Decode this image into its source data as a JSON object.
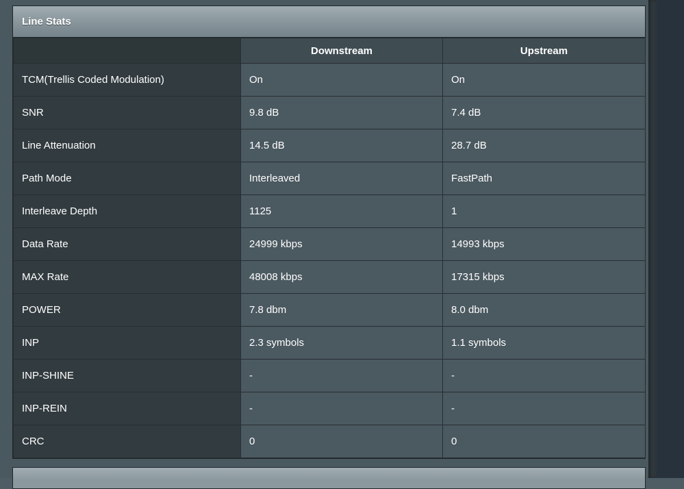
{
  "panel": {
    "title": "Line Stats"
  },
  "columns": {
    "downstream": "Downstream",
    "upstream": "Upstream"
  },
  "rows": [
    {
      "label": "TCM(Trellis Coded Modulation)",
      "down": "On",
      "up": "On"
    },
    {
      "label": "SNR",
      "down": "9.8 dB",
      "up": "7.4 dB"
    },
    {
      "label": "Line Attenuation",
      "down": "14.5 dB",
      "up": "28.7 dB"
    },
    {
      "label": "Path Mode",
      "down": "Interleaved",
      "up": "FastPath"
    },
    {
      "label": "Interleave Depth",
      "down": "1125",
      "up": "1"
    },
    {
      "label": "Data Rate",
      "down": "24999 kbps",
      "up": "14993 kbps"
    },
    {
      "label": "MAX Rate",
      "down": "48008 kbps",
      "up": "17315 kbps"
    },
    {
      "label": "POWER",
      "down": "7.8 dbm",
      "up": "8.0 dbm"
    },
    {
      "label": "INP",
      "down": "2.3 symbols",
      "up": "1.1 symbols"
    },
    {
      "label": "INP-SHINE",
      "down": "-",
      "up": "-"
    },
    {
      "label": "INP-REIN",
      "down": "-",
      "up": "-"
    },
    {
      "label": "CRC",
      "down": "0",
      "up": "0"
    }
  ]
}
